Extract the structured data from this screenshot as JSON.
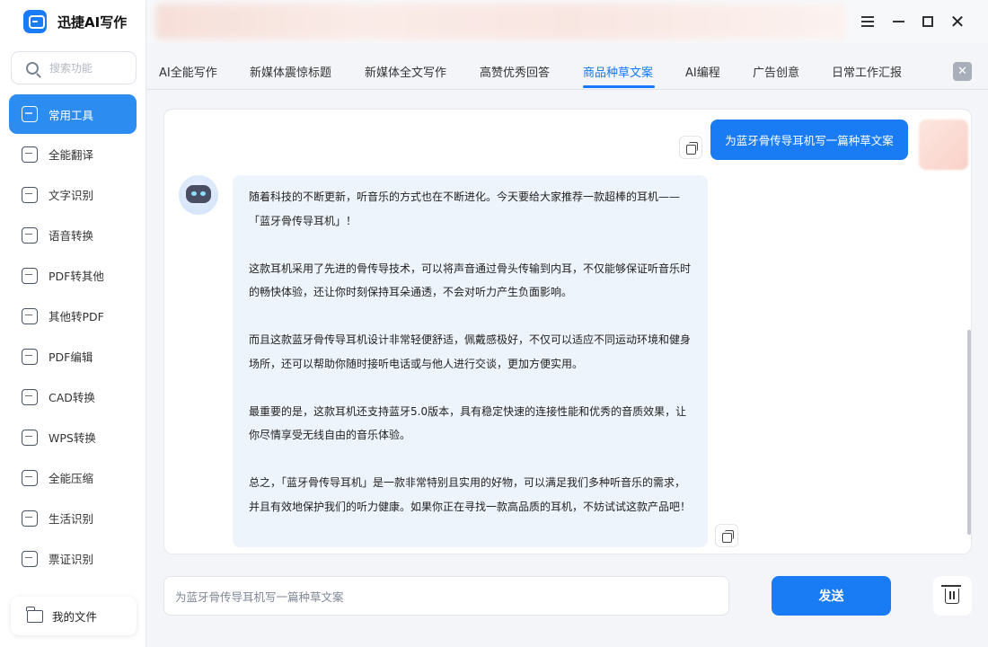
{
  "app": {
    "title": "迅捷AI写作"
  },
  "sidebar": {
    "search_placeholder": "搜索功能",
    "items": [
      {
        "label": "常用工具",
        "icon": "toolbox-icon",
        "active": true
      },
      {
        "label": "全能翻译",
        "icon": "translate-icon"
      },
      {
        "label": "文字识别",
        "icon": "text-recognition-icon"
      },
      {
        "label": "语音转换",
        "icon": "voice-convert-icon"
      },
      {
        "label": "PDF转其他",
        "icon": "pdf-convert-icon"
      },
      {
        "label": "其他转PDF",
        "icon": "to-pdf-icon"
      },
      {
        "label": "PDF编辑",
        "icon": "pdf-edit-icon"
      },
      {
        "label": "CAD转换",
        "icon": "cad-convert-icon"
      },
      {
        "label": "WPS转换",
        "icon": "wps-convert-icon"
      },
      {
        "label": "全能压缩",
        "icon": "compress-icon"
      },
      {
        "label": "生活识别",
        "icon": "life-recognition-icon"
      },
      {
        "label": "票证识别",
        "icon": "ticket-recognition-icon"
      }
    ],
    "my_files": "我的文件"
  },
  "tabs": [
    {
      "label": "AI全能写作"
    },
    {
      "label": "新媒体震惊标题"
    },
    {
      "label": "新媒体全文写作"
    },
    {
      "label": "高赞优秀回答"
    },
    {
      "label": "商品种草文案",
      "active": true
    },
    {
      "label": "AI编程"
    },
    {
      "label": "广告创意"
    },
    {
      "label": "日常工作汇报"
    }
  ],
  "chat": {
    "user_message": "为蓝牙骨传导耳机写一篇种草文案",
    "bot_paragraphs": [
      "随着科技的不断更新，听音乐的方式也在不断进化。今天要给大家推荐一款超棒的耳机——「蓝牙骨传导耳机」！",
      "这款耳机采用了先进的骨传导技术，可以将声音通过骨头传输到内耳，不仅能够保证听音乐时的畅快体验，还让你时刻保持耳朵通透，不会对听力产生负面影响。",
      "而且这款蓝牙骨传导耳机设计非常轻便舒适，佩戴感极好，不仅可以适应不同运动环境和健身场所，还可以帮助你随时接听电话或与他人进行交谈，更加方便实用。",
      "最重要的是，这款耳机还支持蓝牙5.0版本，具有稳定快速的连接性能和优秀的音质效果，让你尽情享受无线自由的音乐体验。",
      "总之，「蓝牙骨传导耳机」是一款非常特别且实用的好物，可以满足我们多种听音乐的需求，并且有效地保护我们的听力健康。如果你正在寻找一款高品质的耳机，不妨试试这款产品吧！"
    ]
  },
  "input": {
    "value": "为蓝牙骨传导耳机写一篇种草文案"
  },
  "send_label": "发送",
  "colors": {
    "accent": "#1a7cf5",
    "active_tab": "#1677ff"
  }
}
